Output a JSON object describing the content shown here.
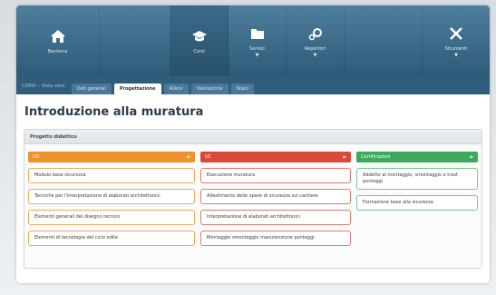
{
  "nav": {
    "items": [
      {
        "label": "Bacheca",
        "icon": "home-icon"
      },
      {
        "label": "Corsi",
        "icon": "graduation-cap-icon"
      },
      {
        "label": "Servizi",
        "icon": "folder-icon"
      },
      {
        "label": "Repertori",
        "icon": "gears-icon"
      },
      {
        "label": "Strumenti",
        "icon": "tools-icon"
      }
    ]
  },
  "breadcrumb": {
    "root": "CORSI",
    "current": "Vista corsi"
  },
  "tabs": [
    "Dati generali",
    "Progettazione",
    "Allievi",
    "Valutazione",
    "Stato"
  ],
  "page_title": "Introduzione alla muratura",
  "panel_title": "Progetto didattico",
  "columns": {
    "ud": {
      "title": "UD",
      "items": [
        "Modulo base sicurezza",
        "Tecniche per l'interpretazione di elaborati architettonici",
        "Elementi generali del disegno tecnico",
        "Elementi di tecnologia del ciclo edile"
      ]
    },
    "uc": {
      "title": "UC",
      "items": [
        "Esecuzione muratura",
        "Allestimento delle opere di sicurezza sul cantiere",
        "Interpretazione di elaborati architettonici",
        "Montaggio smontaggio manutenzione ponteggi"
      ]
    },
    "cert": {
      "title": "Certificazioni",
      "items": [
        "Addetto al montaggio, smontaggio e trasf. ponteggi",
        "Formazione base alla sicurezza"
      ]
    }
  },
  "colors": {
    "ud": "#f0922b",
    "uc": "#d9493a",
    "cert": "#3caa5a",
    "nav": "#3a6a8a"
  }
}
